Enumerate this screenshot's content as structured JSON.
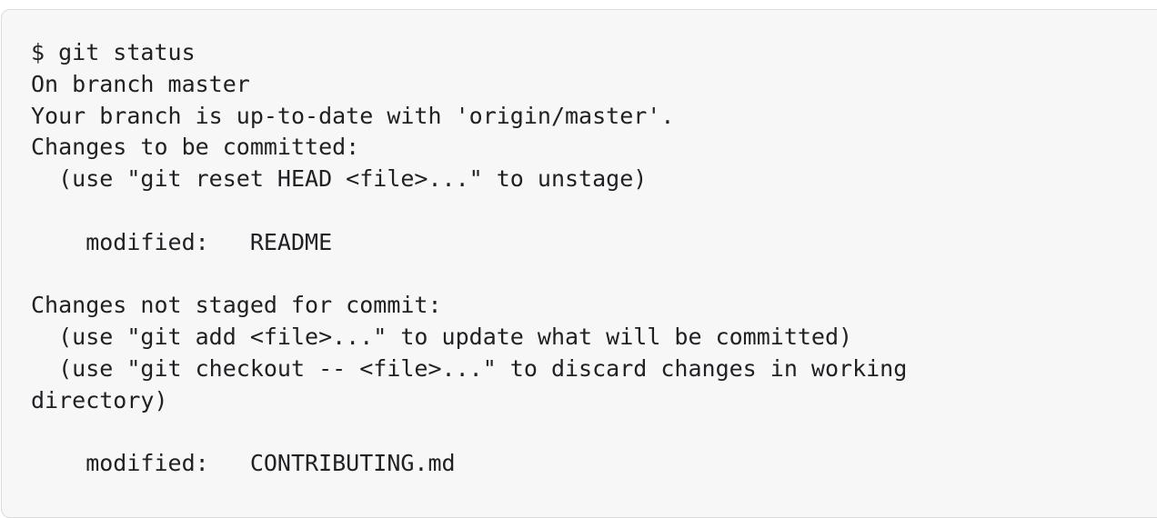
{
  "terminal": {
    "lines": [
      "$ git status",
      "On branch master",
      "Your branch is up-to-date with 'origin/master'.",
      "Changes to be committed:",
      "  (use \"git reset HEAD <file>...\" to unstage)",
      "",
      "    modified:   README",
      "",
      "Changes not staged for commit:",
      "  (use \"git add <file>...\" to update what will be committed)",
      "  (use \"git checkout -- <file>...\" to discard changes in working",
      "directory)",
      "",
      "    modified:   CONTRIBUTING.md"
    ]
  }
}
